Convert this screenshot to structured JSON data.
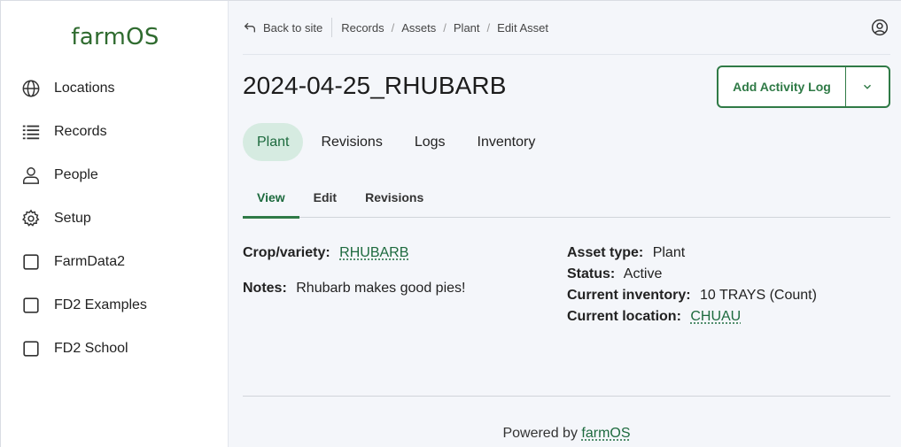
{
  "sidebar": {
    "logo": "farmOS",
    "items": [
      {
        "label": "Locations",
        "icon": "globe-icon"
      },
      {
        "label": "Records",
        "icon": "list-icon"
      },
      {
        "label": "People",
        "icon": "person-icon"
      },
      {
        "label": "Setup",
        "icon": "gear-icon"
      },
      {
        "label": "FarmData2",
        "icon": "square-icon"
      },
      {
        "label": "FD2 Examples",
        "icon": "square-icon"
      },
      {
        "label": "FD2 School",
        "icon": "square-icon"
      }
    ]
  },
  "topbar": {
    "back_label": "Back to site",
    "breadcrumbs": [
      "Records",
      "Assets",
      "Plant",
      "Edit Asset"
    ],
    "user_icon": "user-circle-icon"
  },
  "page": {
    "title": "2024-04-25_RHUBARB",
    "action_label": "Add Activity Log",
    "tabs": [
      {
        "label": "Plant",
        "active": true
      },
      {
        "label": "Revisions",
        "active": false
      },
      {
        "label": "Logs",
        "active": false
      },
      {
        "label": "Inventory",
        "active": false
      }
    ],
    "subtabs": [
      {
        "label": "View",
        "active": true
      },
      {
        "label": "Edit",
        "active": false
      },
      {
        "label": "Revisions",
        "active": false
      }
    ]
  },
  "details": {
    "crop_label": "Crop/variety:",
    "crop_value": "RHUBARB",
    "notes_label": "Notes:",
    "notes_value": "Rhubarb makes good pies!",
    "asset_type_label": "Asset type:",
    "asset_type_value": "Plant",
    "status_label": "Status:",
    "status_value": "Active",
    "inventory_label": "Current inventory:",
    "inventory_value": "10 TRAYS (Count)",
    "location_label": "Current location:",
    "location_value": "CHUAU"
  },
  "footer": {
    "prefix": "Powered by",
    "link": "farmOS"
  },
  "colors": {
    "brand_green": "#2f7a46",
    "active_tab_bg": "#d6ebe1",
    "page_bg": "#f4f6fa"
  }
}
